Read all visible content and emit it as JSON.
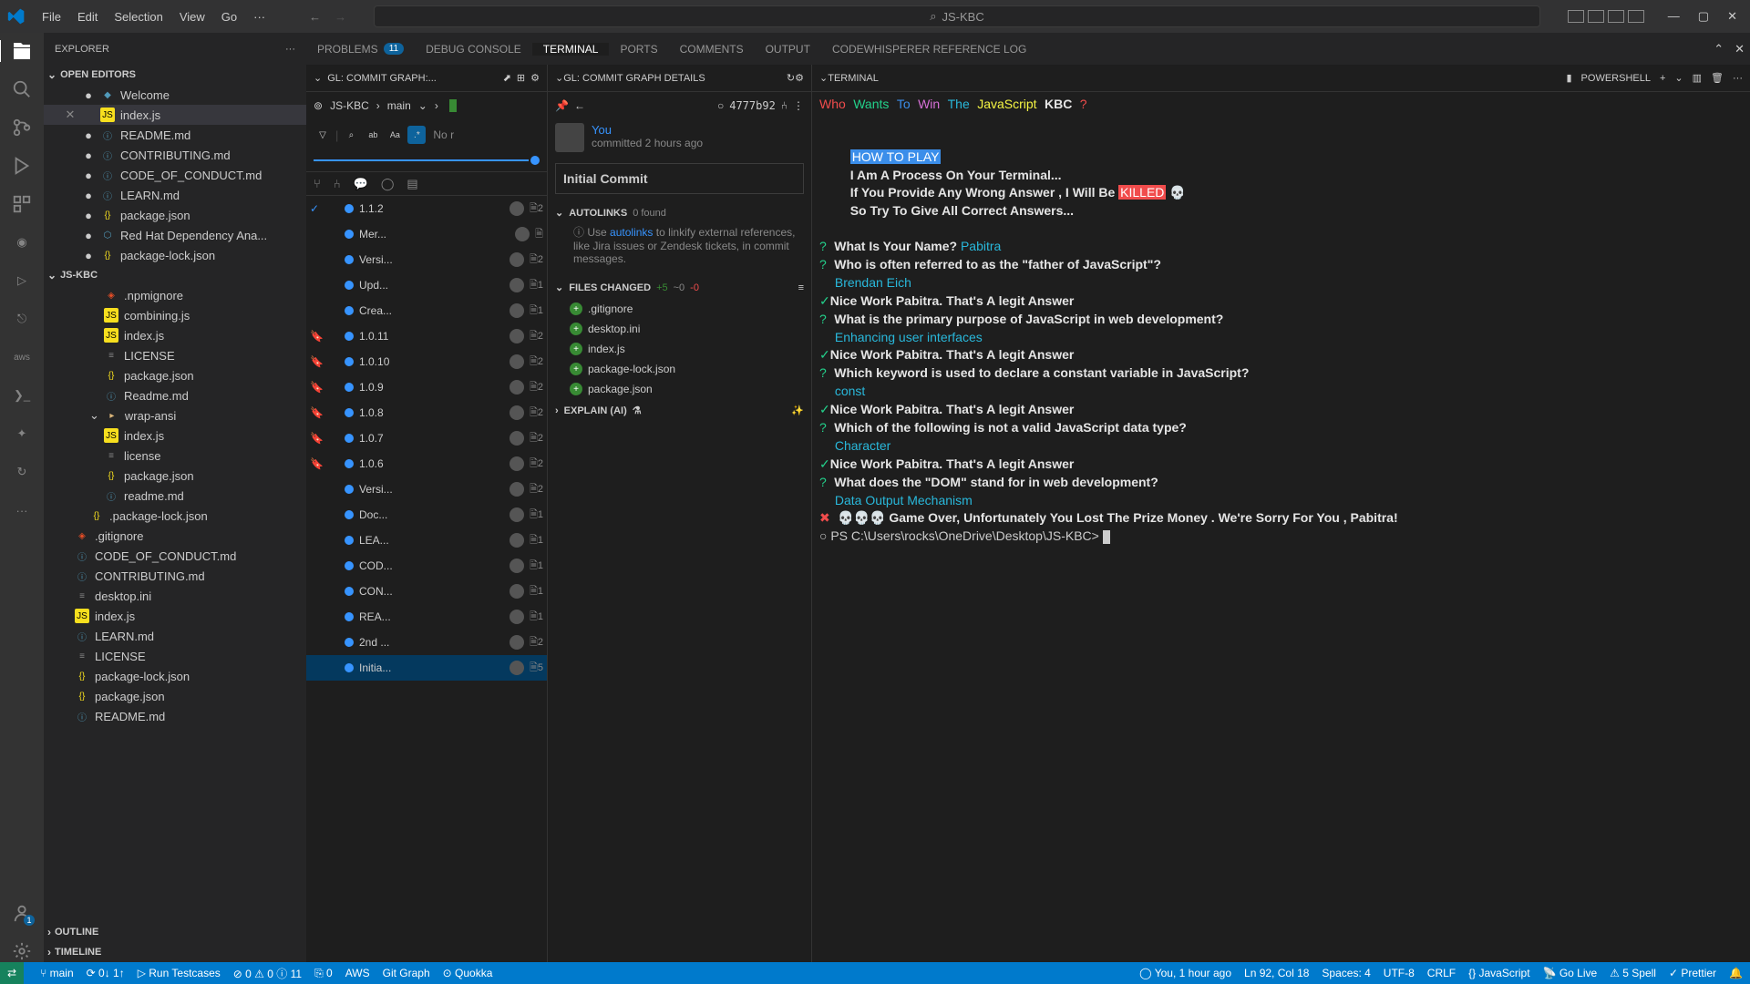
{
  "menu": {
    "file": "File",
    "edit": "Edit",
    "selection": "Selection",
    "view": "View",
    "go": "Go",
    "more": "···"
  },
  "titlebar": {
    "search": "JS-KBC"
  },
  "sidebar": {
    "title": "EXPLORER",
    "sections": {
      "open": "OPEN EDITORS",
      "project": "JS-KBC",
      "outline": "OUTLINE",
      "timeline": "TIMELINE"
    },
    "open_editors": [
      {
        "name": "Welcome",
        "icon": "vs"
      },
      {
        "name": "index.js",
        "icon": "js",
        "active": true
      },
      {
        "name": "README.md",
        "icon": "md"
      },
      {
        "name": "CONTRIBUTING.md",
        "icon": "md"
      },
      {
        "name": "CODE_OF_CONDUCT.md",
        "icon": "md"
      },
      {
        "name": "LEARN.md",
        "icon": "md"
      },
      {
        "name": "package.json",
        "icon": "json"
      },
      {
        "name": "Red Hat Dependency Ana...",
        "icon": "ext"
      },
      {
        "name": "package-lock.json",
        "icon": "json"
      }
    ],
    "tree": [
      {
        "name": ".npmignore",
        "icon": "git",
        "indent": 2
      },
      {
        "name": "combining.js",
        "icon": "js",
        "indent": 2
      },
      {
        "name": "index.js",
        "icon": "js",
        "indent": 2
      },
      {
        "name": "LICENSE",
        "icon": "txt",
        "indent": 2
      },
      {
        "name": "package.json",
        "icon": "json",
        "indent": 2
      },
      {
        "name": "Readme.md",
        "icon": "md",
        "indent": 2
      },
      {
        "name": "wrap-ansi",
        "icon": "folder",
        "indent": 1,
        "expanded": true
      },
      {
        "name": "index.js",
        "icon": "js",
        "indent": 2
      },
      {
        "name": "license",
        "icon": "txt",
        "indent": 2
      },
      {
        "name": "package.json",
        "icon": "json",
        "indent": 2
      },
      {
        "name": "readme.md",
        "icon": "md",
        "indent": 2
      },
      {
        "name": ".package-lock.json",
        "icon": "json",
        "indent": 1
      },
      {
        "name": ".gitignore",
        "icon": "git",
        "indent": 0
      },
      {
        "name": "CODE_OF_CONDUCT.md",
        "icon": "md",
        "indent": 0
      },
      {
        "name": "CONTRIBUTING.md",
        "icon": "md",
        "indent": 0
      },
      {
        "name": "desktop.ini",
        "icon": "txt",
        "indent": 0
      },
      {
        "name": "index.js",
        "icon": "js",
        "indent": 0
      },
      {
        "name": "LEARN.md",
        "icon": "md",
        "indent": 0
      },
      {
        "name": "LICENSE",
        "icon": "txt",
        "indent": 0
      },
      {
        "name": "package-lock.json",
        "icon": "json",
        "indent": 0
      },
      {
        "name": "package.json",
        "icon": "json",
        "indent": 0
      },
      {
        "name": "README.md",
        "icon": "md",
        "indent": 0
      }
    ]
  },
  "tabs": [
    {
      "label": "PROBLEMS",
      "badge": "11"
    },
    {
      "label": "DEBUG CONSOLE"
    },
    {
      "label": "TERMINAL",
      "active": true
    },
    {
      "label": "PORTS"
    },
    {
      "label": "COMMENTS"
    },
    {
      "label": "OUTPUT"
    },
    {
      "label": "CODEWHISPERER REFERENCE LOG"
    }
  ],
  "gitgraph": {
    "title": "GL: COMMIT GRAPH:...",
    "repo": "JS-KBC",
    "branch": "main",
    "search_placeholder": "No r",
    "commits": [
      {
        "msg": "1.1.2",
        "files": "2",
        "badge": "check"
      },
      {
        "msg": "Mer...",
        "files": "",
        "badge": ""
      },
      {
        "msg": "Versi...",
        "files": "2",
        "badge": ""
      },
      {
        "msg": "Upd...",
        "files": "1",
        "badge": ""
      },
      {
        "msg": "Crea...",
        "files": "1",
        "badge": ""
      },
      {
        "msg": "1.0.11",
        "files": "2",
        "badge": "tag"
      },
      {
        "msg": "1.0.10",
        "files": "2",
        "badge": "tag"
      },
      {
        "msg": "1.0.9",
        "files": "2",
        "badge": "tag"
      },
      {
        "msg": "1.0.8",
        "files": "2",
        "badge": "tag"
      },
      {
        "msg": "1.0.7",
        "files": "2",
        "badge": "tag"
      },
      {
        "msg": "1.0.6",
        "files": "2",
        "badge": "tag"
      },
      {
        "msg": "Versi...",
        "files": "2",
        "badge": ""
      },
      {
        "msg": "Doc...",
        "files": "1",
        "badge": ""
      },
      {
        "msg": "LEA...",
        "files": "1",
        "badge": ""
      },
      {
        "msg": "COD...",
        "files": "1",
        "badge": ""
      },
      {
        "msg": "CON...",
        "files": "1",
        "badge": ""
      },
      {
        "msg": "REA...",
        "files": "1",
        "badge": ""
      },
      {
        "msg": "2nd ...",
        "files": "2",
        "badge": ""
      },
      {
        "msg": "Initia...",
        "files": "5",
        "badge": "",
        "selected": true
      }
    ]
  },
  "details": {
    "title": "GL: COMMIT GRAPH DETAILS",
    "hash": "4777b92",
    "author": "You",
    "time": "committed 2 hours ago",
    "message": "Initial Commit",
    "autolinks": {
      "label": "AUTOLINKS",
      "count": "0 found",
      "desc_pre": "Use ",
      "link": "autolinks",
      "desc_post": " to linkify external references, like Jira issues or Zendesk tickets, in commit messages."
    },
    "fileschanged": {
      "label": "FILES CHANGED",
      "added": "+5",
      "modbar": "~0",
      "del": "-0"
    },
    "files": [
      ".gitignore",
      "desktop.ini",
      "index.js",
      "package-lock.json",
      "package.json"
    ],
    "explain": "EXPLAIN (AI)"
  },
  "terminal": {
    "title": "TERMINAL",
    "shell": "powershell",
    "banner": [
      "Who",
      "Wants",
      "To",
      "Win",
      "The",
      "JavaScript",
      "KBC",
      "?"
    ],
    "howto": "HOW TO PLAY",
    "intro1": "I Am A Process On Your Terminal...",
    "intro2a": "If You Provide Any Wrong Answer , I Will Be ",
    "intro2b": "KILLED",
    "intro2c": " 💀",
    "intro3": "So Try To Give All Correct Answers...",
    "q0p": "?",
    "q0": "What Is Your Name? ",
    "a0": "Pabitra",
    "q1p": "?",
    "q1": "Who is often referred to as the \"father of JavaScript\"?",
    "a1": "Brendan Eich",
    "ok1": "✓",
    "ok1t": "Nice Work Pabitra. That's A legit Answer",
    "q2p": "?",
    "q2": "What is the primary purpose of JavaScript in web development?",
    "a2": "Enhancing user interfaces",
    "ok2": "✓",
    "ok2t": "Nice Work Pabitra. That's A legit Answer",
    "q3p": "?",
    "q3": "Which keyword is used to declare a constant variable in JavaScript?",
    "a3": "const",
    "ok3": "✓",
    "ok3t": "Nice Work Pabitra. That's A legit Answer",
    "q4p": "?",
    "q4": "Which of the following is not a valid JavaScript data type?",
    "a4": "Character",
    "ok4": "✓",
    "ok4t": "Nice Work Pabitra. That's A legit Answer",
    "q5p": "?",
    "q5": "What does the \"DOM\" stand for in web development?",
    "a5": "Data Output Mechanism",
    "fail": "✖",
    "failt": "💀💀💀 Game Over, Unfortunately You Lost The Prize Money . We're Sorry For You , Pabitra!",
    "prompt": "○ PS C:\\Users\\rocks\\OneDrive\\Desktop\\JS-KBC> "
  },
  "statusbar": {
    "branch": "main",
    "sync": "0↓ 1↑",
    "run": "Run Testcases",
    "errors": "0",
    "warnings": "0",
    "info": "11",
    "ports": "0",
    "aws": "AWS",
    "gitgraph": "Git Graph",
    "quokka": "Quokka",
    "blame": "You, 1 hour ago",
    "lncol": "Ln 92, Col 18",
    "spaces": "Spaces: 4",
    "encoding": "UTF-8",
    "eol": "CRLF",
    "lang": "JavaScript",
    "golive": "Go Live",
    "spell": "5 Spell",
    "prettier": "Prettier"
  }
}
